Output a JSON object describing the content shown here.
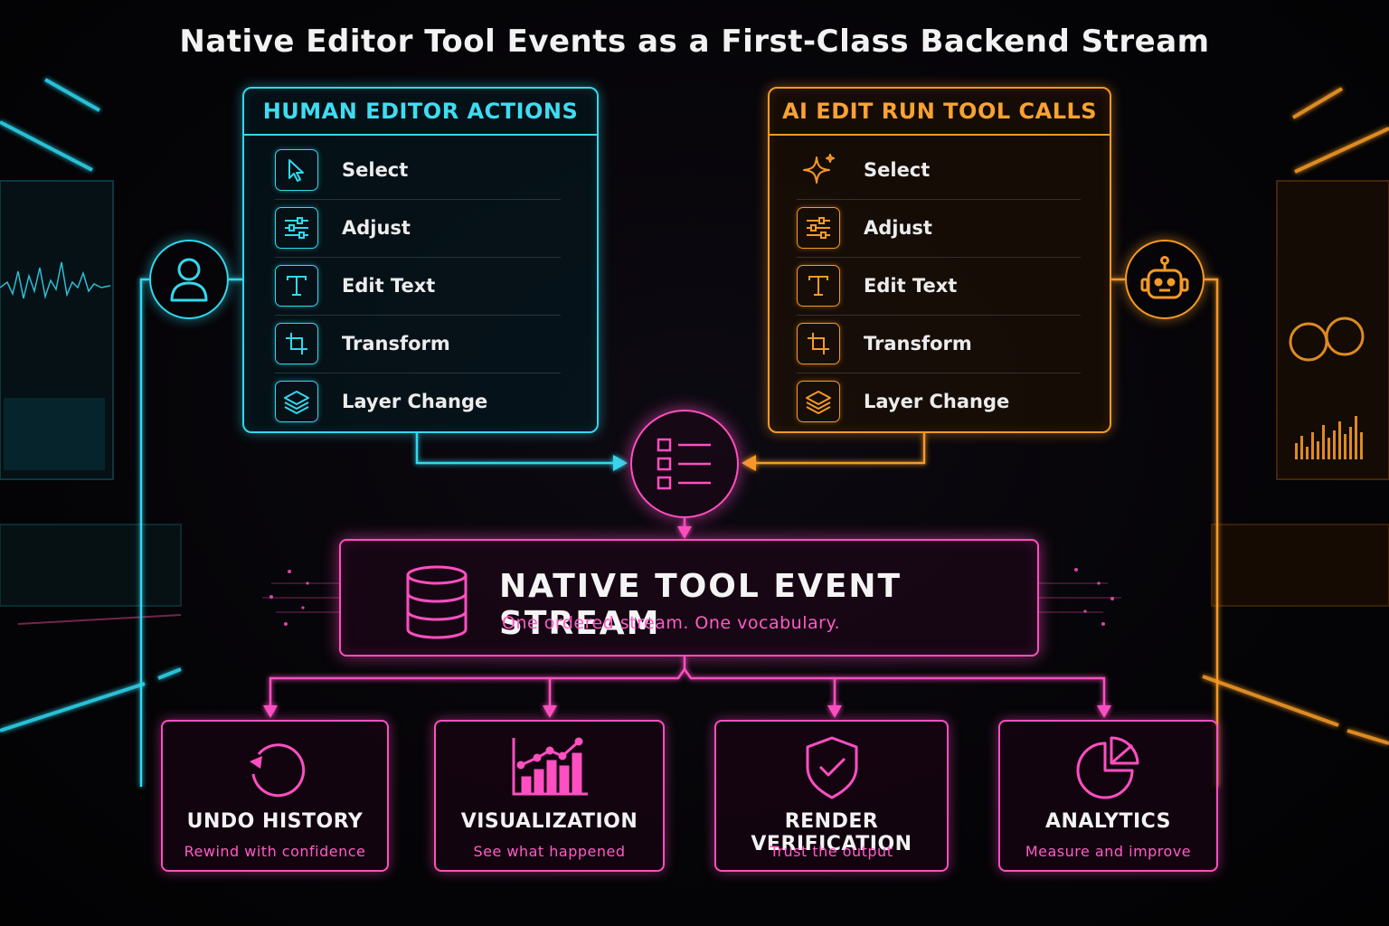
{
  "title": "Native Editor Tool Events as a First-Class Backend Stream",
  "human_panel": {
    "title": "HUMAN EDITOR ACTIONS",
    "items": [
      {
        "label": "Select",
        "icon": "cursor-icon"
      },
      {
        "label": "Adjust",
        "icon": "sliders-icon"
      },
      {
        "label": "Edit Text",
        "icon": "text-icon"
      },
      {
        "label": "Transform",
        "icon": "crop-icon"
      },
      {
        "label": "Layer Change",
        "icon": "layers-icon"
      }
    ]
  },
  "ai_panel": {
    "title": "AI EDIT RUN TOOL CALLS",
    "items": [
      {
        "label": "Select",
        "icon": "sparkle-icon"
      },
      {
        "label": "Adjust",
        "icon": "sliders-icon"
      },
      {
        "label": "Edit Text",
        "icon": "text-icon"
      },
      {
        "label": "Transform",
        "icon": "crop-icon"
      },
      {
        "label": "Layer Change",
        "icon": "layers-icon"
      }
    ]
  },
  "stream": {
    "title": "NATIVE TOOL EVENT STREAM",
    "subtitle": "One ordered stream. One vocabulary."
  },
  "outputs": [
    {
      "name": "UNDO HISTORY",
      "sub": "Rewind with confidence",
      "icon": "undo-icon"
    },
    {
      "name": "VISUALIZATION",
      "sub": "See what happened",
      "icon": "bar-chart-icon"
    },
    {
      "name": "RENDER VERIFICATION",
      "sub": "Trust the output",
      "icon": "shield-check-icon"
    },
    {
      "name": "ANALYTICS",
      "sub": "Measure and improve",
      "icon": "pie-chart-icon"
    }
  ],
  "colors": {
    "human": "#33d8ee",
    "ai": "#f59a26",
    "stream": "#ff4fc1"
  }
}
